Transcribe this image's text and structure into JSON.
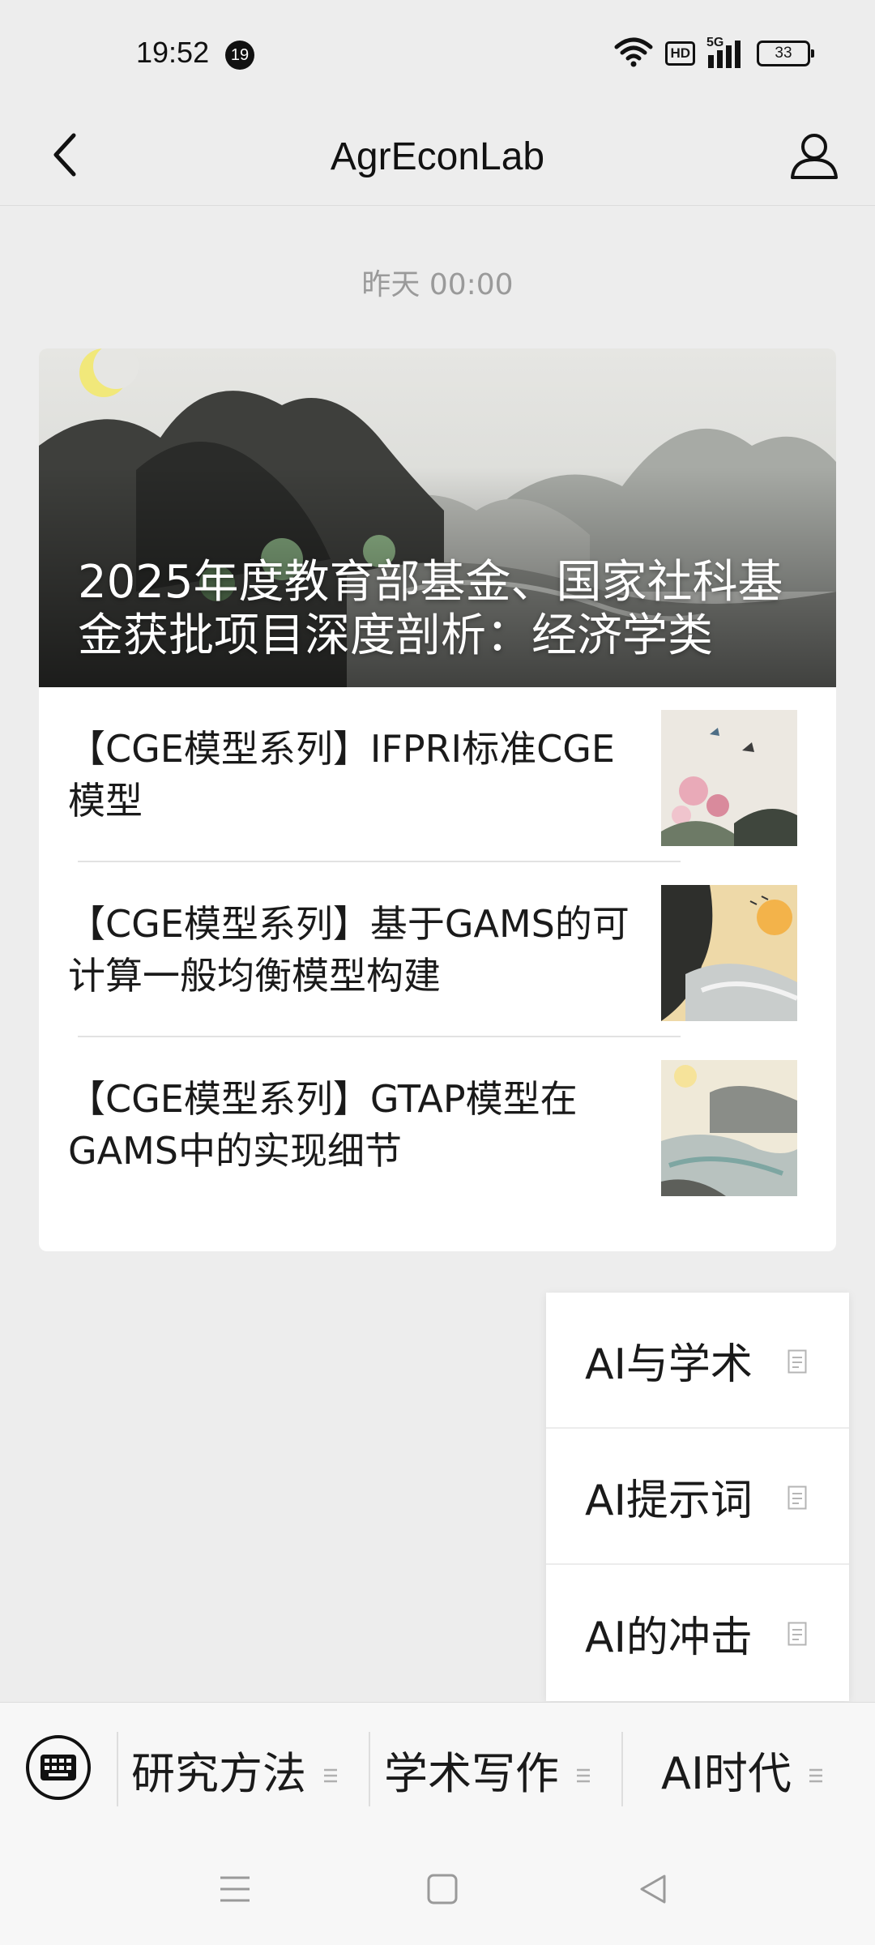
{
  "status_bar": {
    "time": "19:52",
    "notification_count": "19",
    "network_type": "5G",
    "hd_label": "HD",
    "battery": "33"
  },
  "nav": {
    "title": "AgrEconLab",
    "back_icon": "chevron-left-icon",
    "profile_icon": "person-icon"
  },
  "chat": {
    "timestamp": "昨天 00:00"
  },
  "article_card": {
    "cover_title": "2025年度教育部基金、国家社科基金获批项目深度剖析：经济学类",
    "items": [
      {
        "title": "【CGE模型系列】IFPRI标准CGE模型"
      },
      {
        "title": "【CGE模型系列】基于GAMS的可计算一般均衡模型构建"
      },
      {
        "title": "【CGE模型系列】GTAP模型在GAMS中的实现细节"
      }
    ]
  },
  "submenu": {
    "items": [
      {
        "label": "AI与学术",
        "icon": "document-icon"
      },
      {
        "label": "AI提示词",
        "icon": "document-icon"
      },
      {
        "label": "AI的冲击",
        "icon": "document-icon"
      }
    ]
  },
  "menu_bar": {
    "keyboard_icon": "keyboard-icon",
    "items": [
      {
        "label": "研究方法"
      },
      {
        "label": "学术写作"
      },
      {
        "label": "AI时代"
      }
    ]
  },
  "system_nav": {
    "menu_icon": "menu-icon",
    "home_icon": "home-square-icon",
    "back_icon": "back-triangle-icon"
  },
  "colors": {
    "page_bg": "#ededed",
    "card_bg": "#ffffff",
    "timestamp": "#9a9a9a",
    "text": "#1a1a1a"
  }
}
